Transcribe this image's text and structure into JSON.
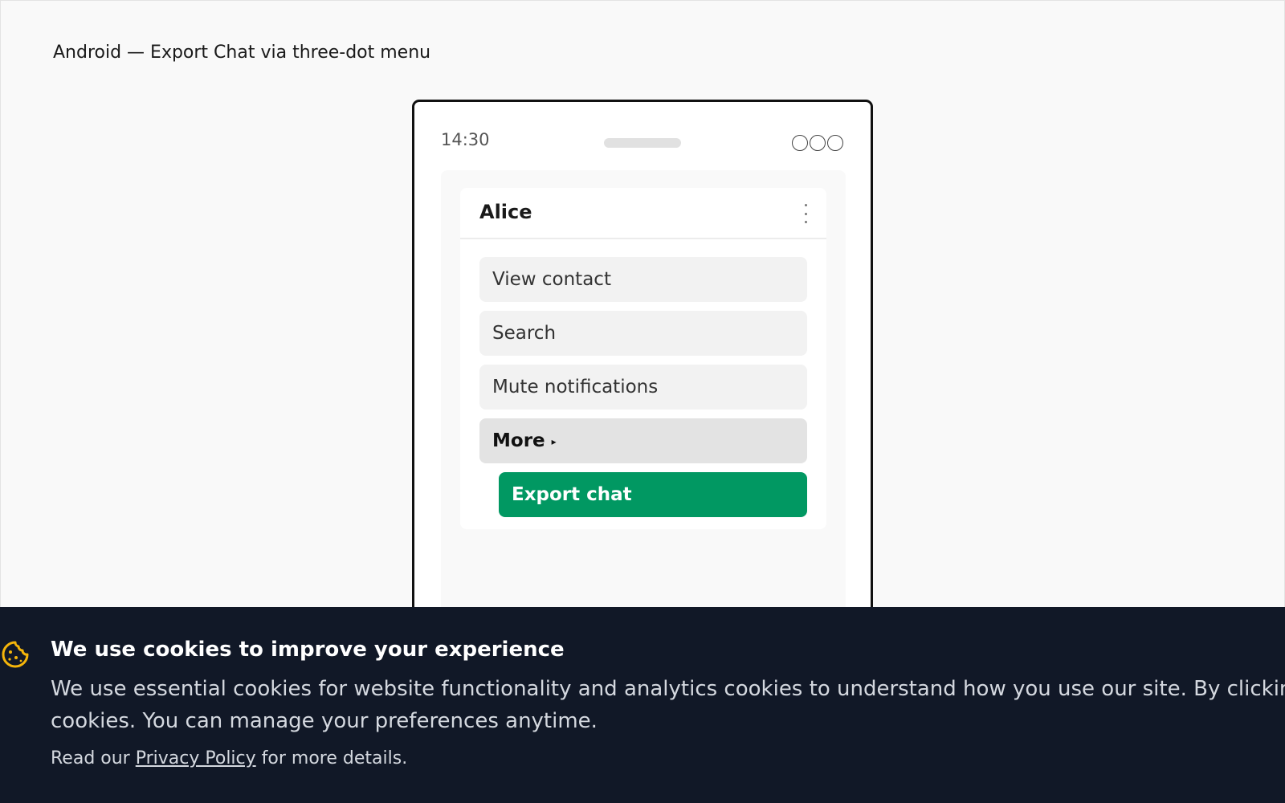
{
  "page": {
    "heading": "Android — Export Chat via three-dot menu"
  },
  "phone": {
    "status_time": "14:30",
    "chat": {
      "contact_name": "Alice",
      "menu_icon": "three-dot-vertical-icon",
      "menu_items": [
        {
          "label": "View contact"
        },
        {
          "label": "Search"
        },
        {
          "label": "Mute notifications"
        },
        {
          "label": "More",
          "submenu_indicator": "▸"
        }
      ],
      "submenu_action": "Export chat"
    }
  },
  "cookie_banner": {
    "icon": "cookie-icon",
    "title": "We use cookies to improve your experience",
    "body": "We use essential cookies for website functionality and analytics cookies to understand how you use our site. By clicking of cookies. You can manage your preferences anytime.",
    "privacy_prefix": "Read our",
    "privacy_link": "Privacy Policy",
    "privacy_suffix": "for more details."
  },
  "colors": {
    "accent_green": "#019862",
    "banner_bg": "#111827",
    "cookie_icon": "#f5b50a"
  }
}
